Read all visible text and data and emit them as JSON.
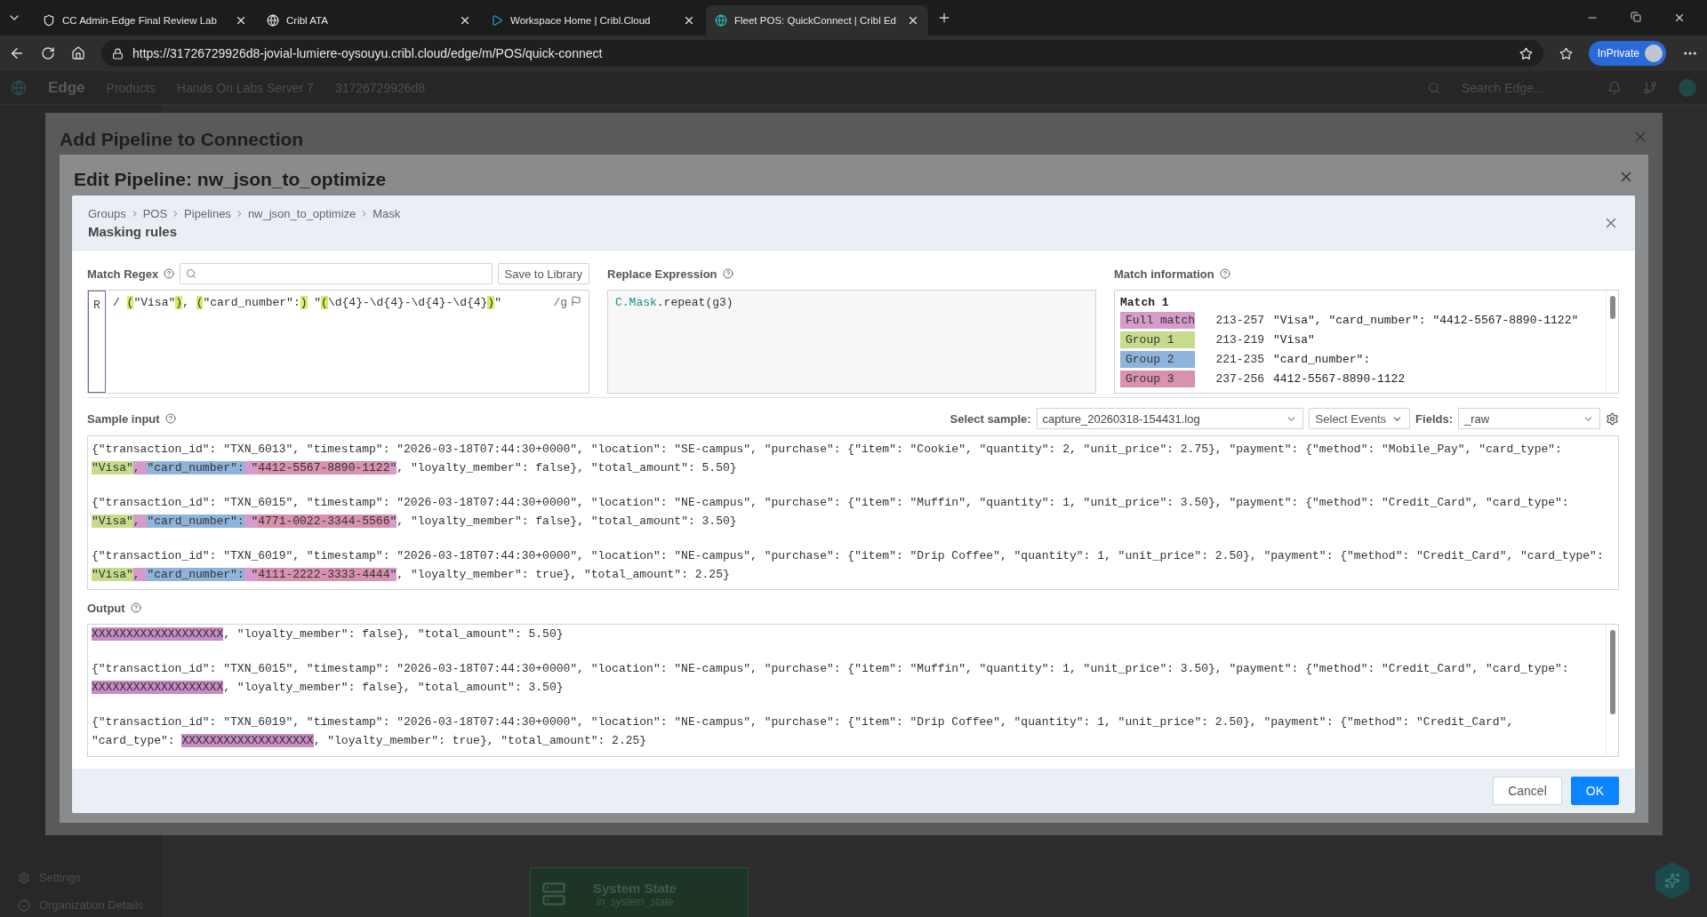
{
  "browser": {
    "tabs": [
      {
        "title": "CC Admin-Edge Final Review Lab",
        "kind": "shield",
        "selected": false
      },
      {
        "title": "Cribl ATA",
        "kind": "globe",
        "selected": false
      },
      {
        "title": "Workspace Home | Cribl.Cloud",
        "kind": "play",
        "selected": false
      },
      {
        "title": "Fleet POS: QuickConnect | Cribl Ed",
        "kind": "cribl",
        "selected": true
      }
    ],
    "url": "https://31726729926d8-jovial-lumiere-oysouyu.cribl.cloud/edge/m/POS/quick-connect",
    "inprivate": "InPrivate"
  },
  "app": {
    "brand": "Edge",
    "header_items": [
      "Products",
      "Hands On Labs Server 7",
      "31726729926d8"
    ],
    "search_placeholder": "Search Edge...",
    "sidebar_footer": [
      "Settings",
      "Organization Details"
    ],
    "node": {
      "title": "System State",
      "subtitle": "in_system_state"
    }
  },
  "outer_modal": {
    "title": "Add Pipeline to Connection"
  },
  "edit_modal": {
    "title": "Edit Pipeline: nw_json_to_optimize"
  },
  "masking_dialog": {
    "breadcrumb": [
      "Groups",
      "POS",
      "Pipelines",
      "nw_json_to_optimize",
      "Mask"
    ],
    "title": "Masking rules",
    "match_regex": {
      "label": "Match Regex",
      "save_button": "Save to Library",
      "mode": "R",
      "flags": "/g",
      "segments": [
        {
          "text": "/ ",
          "kind": "plain"
        },
        {
          "text": "(",
          "kind": "paren"
        },
        {
          "text": "\"Visa\"",
          "kind": "plain"
        },
        {
          "text": ")",
          "kind": "paren"
        },
        {
          "text": ", ",
          "kind": "plain"
        },
        {
          "text": "(",
          "kind": "paren"
        },
        {
          "text": "\"card_number\":",
          "kind": "plain"
        },
        {
          "text": ")",
          "kind": "paren"
        },
        {
          "text": " \"",
          "kind": "plain"
        },
        {
          "text": "(",
          "kind": "paren"
        },
        {
          "text": "\\d{4}-\\d{4}-\\d{4}-\\d{4}",
          "kind": "plain"
        },
        {
          "text": ")",
          "kind": "paren"
        },
        {
          "text": "\"",
          "kind": "plain"
        }
      ]
    },
    "replace_expression": {
      "label": "Replace Expression",
      "segments": [
        {
          "text": "C.Mask",
          "kind": "object"
        },
        {
          "text": ".repeat(g3)",
          "kind": "plain"
        }
      ]
    },
    "match_information": {
      "label": "Match information",
      "match_title": "Match 1",
      "rows": [
        {
          "label": "Full match",
          "color": "#d59ccb",
          "range": "213-257",
          "value": "\"Visa\", \"card_number\": \"4412-5567-8890-1122\""
        },
        {
          "label": "Group 1",
          "color": "#c6dc8c",
          "range": "213-219",
          "value": "\"Visa\""
        },
        {
          "label": "Group 2",
          "color": "#8eb4dc",
          "range": "221-235",
          "value": "\"card_number\":"
        },
        {
          "label": "Group 3",
          "color": "#d892b0",
          "range": "237-256",
          "value": "4412-5567-8890-1122"
        }
      ]
    },
    "sample_input": {
      "label": "Sample input",
      "select_sample_label": "Select sample:",
      "sample_file": "capture_20260318-154431.log",
      "select_events": "Select Events",
      "fields_label": "Fields:",
      "fields_value": "_raw",
      "events": [
        {
          "segments": [
            {
              "text": "{\"transaction_id\": \"TXN_6013\", \"timestamp\": \"2026-03-18T07:44:30+0000\", \"location\": \"SE-campus\", \"purchase\": {\"item\": \"Cookie\", \"quantity\": 2, \"unit_price\": 2.75}, \"payment\": {\"method\": \"Mobile_Pay\", \"card_type\": ",
              "kind": "plain"
            },
            {
              "text": "\"Visa\"",
              "kind": "group1"
            },
            {
              "text": ", ",
              "kind": "full"
            },
            {
              "text": "\"card_number\":",
              "kind": "group2"
            },
            {
              "text": " \"",
              "kind": "full"
            },
            {
              "text": "4412-5567-8890-1122",
              "kind": "group3"
            },
            {
              "text": "\"",
              "kind": "full"
            },
            {
              "text": ", \"loyalty_member\": false}, \"total_amount\": 5.50}",
              "kind": "plain"
            }
          ]
        },
        {
          "segments": [
            {
              "text": "{\"transaction_id\": \"TXN_6015\", \"timestamp\": \"2026-03-18T07:44:30+0000\", \"location\": \"NE-campus\", \"purchase\": {\"item\": \"Muffin\", \"quantity\": 1, \"unit_price\": 3.50}, \"payment\": {\"method\": \"Credit_Card\", \"card_type\": ",
              "kind": "plain"
            },
            {
              "text": "\"Visa\"",
              "kind": "group1"
            },
            {
              "text": ", ",
              "kind": "full"
            },
            {
              "text": "\"card_number\":",
              "kind": "group2"
            },
            {
              "text": " \"",
              "kind": "full"
            },
            {
              "text": "4771-0022-3344-5566",
              "kind": "group3"
            },
            {
              "text": "\"",
              "kind": "full"
            },
            {
              "text": ", \"loyalty_member\": false}, \"total_amount\": 3.50}",
              "kind": "plain"
            }
          ]
        },
        {
          "segments": [
            {
              "text": "{\"transaction_id\": \"TXN_6019\", \"timestamp\": \"2026-03-18T07:44:30+0000\", \"location\": \"NE-campus\", \"purchase\": {\"item\": \"Drip Coffee\", \"quantity\": 1, \"unit_price\": 2.50}, \"payment\": {\"method\": \"Credit_Card\", \"card_type\": ",
              "kind": "plain"
            },
            {
              "text": "\"Visa\"",
              "kind": "group1"
            },
            {
              "text": ", ",
              "kind": "full"
            },
            {
              "text": "\"card_number\":",
              "kind": "group2"
            },
            {
              "text": " \"",
              "kind": "full"
            },
            {
              "text": "4111-2222-3333-4444",
              "kind": "group3"
            },
            {
              "text": "\"",
              "kind": "full"
            },
            {
              "text": ", \"loyalty_member\": true}, \"total_amount\": 2.25}",
              "kind": "plain"
            }
          ]
        }
      ]
    },
    "output": {
      "label": "Output",
      "events": [
        {
          "segments": [
            {
              "text": "XXXXXXXXXXXXXXXXXXX",
              "kind": "masked"
            },
            {
              "text": ", \"loyalty_member\": false}, \"total_amount\": 5.50}",
              "kind": "plain"
            }
          ]
        },
        {
          "segments": [
            {
              "text": "{\"transaction_id\": \"TXN_6015\", \"timestamp\": \"2026-03-18T07:44:30+0000\", \"location\": \"NE-campus\", \"purchase\": {\"item\": \"Muffin\", \"quantity\": 1, \"unit_price\": 3.50}, \"payment\": {\"method\": \"Credit_Card\", \"card_type\": ",
              "kind": "plain"
            },
            {
              "text": "XXXXXXXXXXXXXXXXXXX",
              "kind": "masked"
            },
            {
              "text": ", \"loyalty_member\": false}, \"total_amount\": 3.50}",
              "kind": "plain"
            }
          ]
        },
        {
          "segments": [
            {
              "text": "{\"transaction_id\": \"TXN_6019\", \"timestamp\": \"2026-03-18T07:44:30+0000\", \"location\": \"NE-campus\", \"purchase\": {\"item\": \"Drip Coffee\", \"quantity\": 1, \"unit_price\": 2.50}, \"payment\": {\"method\": \"Credit_Card\", \"card_type\": ",
              "kind": "plain"
            },
            {
              "text": "XXXXXXXXXXXXXXXXXXX",
              "kind": "masked"
            },
            {
              "text": ", \"loyalty_member\": true}, \"total_amount\": 2.25}",
              "kind": "plain"
            }
          ]
        }
      ]
    },
    "buttons": {
      "cancel": "Cancel",
      "ok": "OK"
    }
  }
}
